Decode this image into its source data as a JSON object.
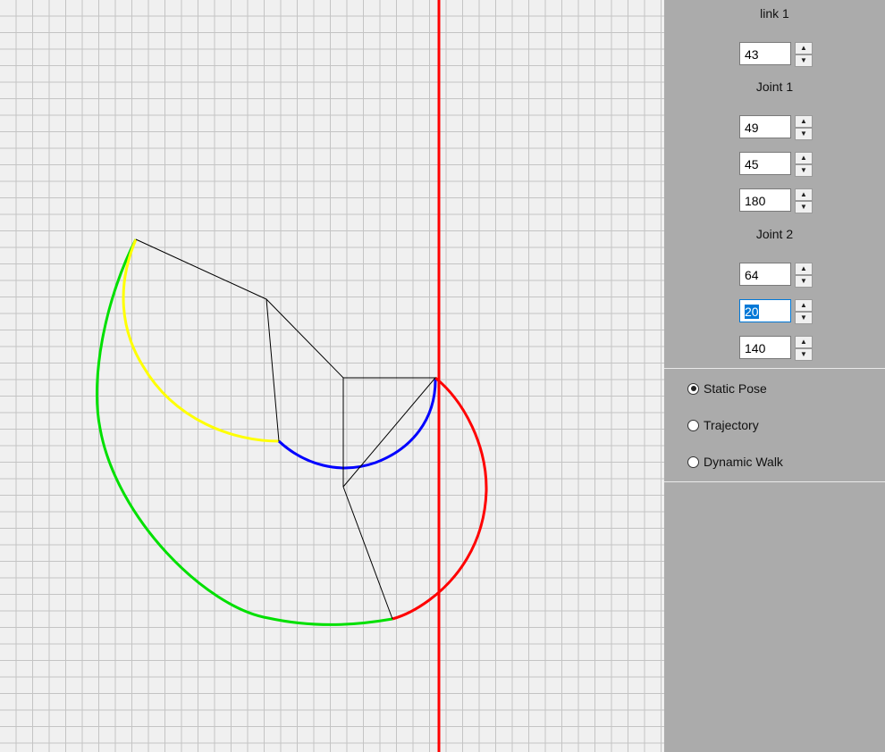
{
  "panel": {
    "link1_label": "link 1",
    "link1_value": "43",
    "joint1_label": "Joint 1",
    "joint1_values": [
      "49",
      "45",
      "180"
    ],
    "joint2_label": "Joint 2",
    "joint2_values": [
      "64",
      "20",
      "140"
    ],
    "modes": [
      {
        "label": "Static Pose",
        "checked": true
      },
      {
        "label": "Trajectory",
        "checked": false
      },
      {
        "label": "Dynamic Walk",
        "checked": false
      }
    ]
  },
  "colors": {
    "axis": "#ff0000",
    "trace_green": "#00e000",
    "trace_yellow": "#ffff00",
    "trace_blue": "#0000ff",
    "trace_red": "#ff0000",
    "links": "#000000",
    "selection": "#0078d7"
  }
}
